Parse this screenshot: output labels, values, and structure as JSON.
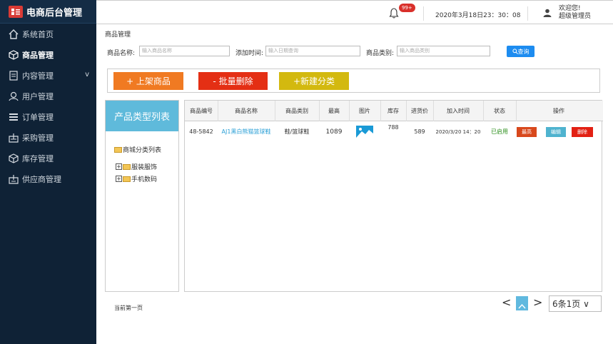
{
  "app": {
    "title": "电商后台管理"
  },
  "sidebar": {
    "items": [
      {
        "label": "系统首页",
        "icon": "home-icon"
      },
      {
        "label": "商品管理",
        "icon": "cube-icon",
        "active": true
      },
      {
        "label": "内容管理",
        "icon": "document-icon",
        "arrow": "v"
      },
      {
        "label": "用户管理",
        "icon": "user-icon"
      },
      {
        "label": "订单管理",
        "icon": "list-icon"
      },
      {
        "label": "采购管理",
        "icon": "purchase-icon"
      },
      {
        "label": "库存管理",
        "icon": "box-icon"
      },
      {
        "label": "供应商管理",
        "icon": "supplier-icon"
      }
    ]
  },
  "topbar": {
    "badge": "99+",
    "datetime": "2020年3月18日23：30：08",
    "welcome_line1": "欢迎您!",
    "welcome_line2": "超级管理员"
  },
  "breadcrumb": "商品管理",
  "search": {
    "name_label": "商品名称:",
    "name_placeholder": "输入商品名称",
    "time_label": "添加时间:",
    "time_placeholder": "输入日期查询",
    "category_label": "商品类别:",
    "category_placeholder": "输入商品类别",
    "query_label": "查询"
  },
  "actions": {
    "add": "+ 上架商品",
    "batch_delete": "- 批量删除",
    "new_category": "+新建分类"
  },
  "category_panel": {
    "title": "产品类型列表",
    "root": "商城分类列表",
    "nodes": [
      "服装服饰",
      "手机数码"
    ]
  },
  "table": {
    "headers": [
      "商品编号",
      "商品名称",
      "商品类别",
      "最高",
      "图片",
      "库存",
      "进货价",
      "加入时间",
      "状态",
      "操作"
    ],
    "rows": [
      {
        "id": "48-5842",
        "name": "AJ1黑白熊猫篮球鞋",
        "category": "鞋/篮球鞋",
        "max": "1089",
        "stock": "788",
        "cost": "589",
        "added": "2020/3/20 14：20",
        "status": "已启用",
        "op_top": "最高",
        "op_edit": "编辑",
        "op_delete": "删除"
      }
    ]
  },
  "footer": {
    "left_text": "当前第一页",
    "page_select": "6条1页 ∨",
    "prev": "<",
    "next": ">"
  },
  "colors": {
    "sidebar_bg": "#0f2236",
    "orange": "#f07a22",
    "red": "#e42f14",
    "yellow": "#d3b90f",
    "blue": "#1d8cf0",
    "teal": "#5fbadb"
  }
}
